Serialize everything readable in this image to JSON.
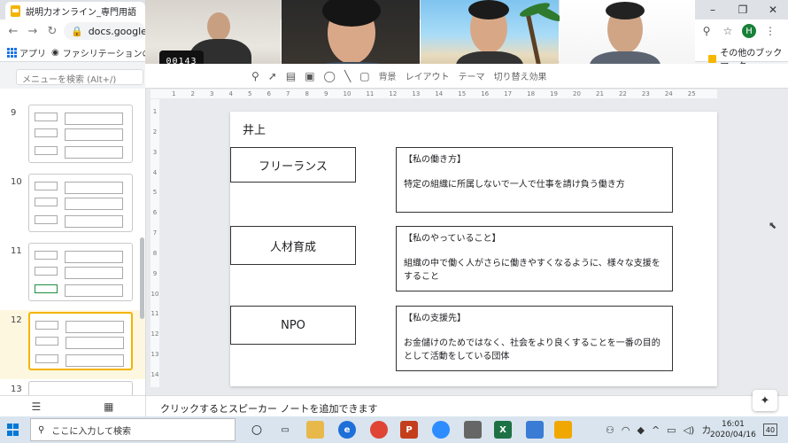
{
  "browser": {
    "tab_title": "説明力オンライン_専門用語 - Goog",
    "url": "docs.google.co",
    "bookmarks": [
      "アプリ",
      "ファシリテーションのナレ..."
    ],
    "other_bookmarks": "その他のブックマーク",
    "profile_initial": "H"
  },
  "video_call": {
    "timer": "00143"
  },
  "slides_app": {
    "menu_search_placeholder": "メニューを検索 (Alt+/)",
    "toolbar_labels": [
      "背景",
      "レイアウト",
      "テーマ",
      "切り替え効果"
    ],
    "ruler_h": [
      "1",
      "2",
      "3",
      "4",
      "5",
      "6",
      "7",
      "8",
      "9",
      "10",
      "11",
      "12",
      "13",
      "14",
      "15",
      "16",
      "17",
      "18",
      "19",
      "20",
      "21",
      "22",
      "23",
      "24",
      "25"
    ],
    "ruler_v": [
      "1",
      "2",
      "3",
      "4",
      "5",
      "6",
      "7",
      "8",
      "9",
      "10",
      "11",
      "12",
      "13",
      "14"
    ],
    "thumbnails": [
      {
        "num": "9"
      },
      {
        "num": "10"
      },
      {
        "num": "11"
      },
      {
        "num": "12",
        "selected": true
      },
      {
        "num": "13"
      }
    ],
    "notes_placeholder": "クリックするとスピーカー ノートを追加できます"
  },
  "slide": {
    "name": "井上",
    "rows": [
      {
        "term": "フリーランス",
        "heading": "【私の働き方】",
        "text": "特定の組織に所属しないで一人で仕事を請け負う働き方"
      },
      {
        "term": "人材育成",
        "heading": "【私のやっていること】",
        "text": "組織の中で働く人がさらに働きやすくなるように、様々な支援をすること"
      },
      {
        "term": "NPO",
        "heading": "【私の支援先】",
        "text": "お金儲けのためではなく、社会をより良くすることを一番の目的として活動をしている団体"
      }
    ]
  },
  "taskbar": {
    "search_placeholder": "ここに入力して検索",
    "ime": "カ",
    "time": "16:01",
    "date": "2020/04/16",
    "notifications": "40"
  },
  "colors": {
    "accent": "#f4b400",
    "selected_thumb_bg": "#fef7e0",
    "taskbar": "#d9e4ee"
  },
  "icons": [
    "slides-favicon",
    "back-icon",
    "forward-icon",
    "reload-icon",
    "lock-icon",
    "zoom-icon",
    "star-icon",
    "menu-dots-icon",
    "apps-icon",
    "folder-icon",
    "grid-view-icon",
    "filmstrip-icon",
    "explore-icon",
    "windows-icon",
    "search-icon",
    "cortana-icon",
    "task-view-icon"
  ]
}
